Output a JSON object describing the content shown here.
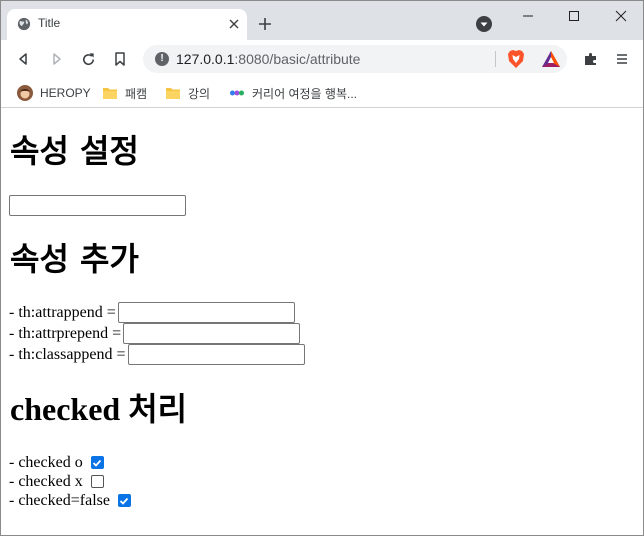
{
  "browser": {
    "tab_title": "Title",
    "url_host": "127.0.0.1",
    "url_rest": ":8080/basic/attribute",
    "bookmarks": [
      "HEROPY",
      "패캠",
      "강의",
      "커리어 여정을 행복..."
    ]
  },
  "page": {
    "heading_attr_set": "속성 설정",
    "heading_attr_add": "속성 추가",
    "attrappend_label": "- th:attrappend = ",
    "attrprepend_label": "- th:attrprepend = ",
    "classappend_label": "- th:classappend = ",
    "heading_checked_en": "checked",
    "heading_checked_ko": "처리",
    "checked_o_label": "- checked o",
    "checked_x_label": "- checked x",
    "checked_false_label": "- checked=false",
    "checked_o_state": true,
    "checked_x_state": false,
    "checked_false_state": true
  },
  "colors": {
    "checkbox_accent": "#0a74e6",
    "tabstrip": "#dee1e6",
    "omnibox": "#f1f3f4"
  }
}
